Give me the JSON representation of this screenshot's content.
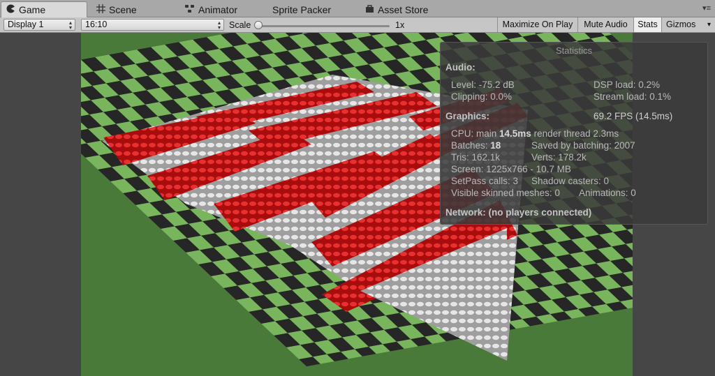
{
  "tabs": [
    {
      "label": "Game",
      "icon": "pacman-icon"
    },
    {
      "label": "Scene",
      "icon": "grid-icon"
    },
    {
      "label": "Animator",
      "icon": "animator-icon"
    },
    {
      "label": "Sprite Packer",
      "icon": ""
    },
    {
      "label": "Asset Store",
      "icon": "bag-icon"
    }
  ],
  "toolbar": {
    "display": "Display 1",
    "aspect": "16:10",
    "scale_label": "Scale",
    "scale_value": "1x",
    "maximize": "Maximize On Play",
    "mute": "Mute Audio",
    "stats": "Stats",
    "gizmos": "Gizmos"
  },
  "stats": {
    "title": "Statistics",
    "audio_header": "Audio:",
    "level": "Level: -75.2 dB",
    "clipping": "Clipping: 0.0%",
    "dsp": "DSP load: 0.2%",
    "stream": "Stream load: 0.1%",
    "graphics_header": "Graphics:",
    "fps": "69.2 FPS (14.5ms)",
    "cpu_prefix": "CPU: main ",
    "cpu_main": "14.5ms",
    "cpu_render": "  render thread 2.3ms",
    "batches_prefix": "Batches: ",
    "batches": "18",
    "saved": "Saved by batching: 2007",
    "tris": "Tris: 162.1k",
    "verts": "Verts: 178.2k",
    "screen": "Screen: 1225x766 - 10.7 MB",
    "setpass": "SetPass calls: 3",
    "shadow": "Shadow casters: 0",
    "skinned": "Visible skinned meshes: 0",
    "animations": "Animations: 0",
    "network": "Network: (no players connected)"
  },
  "colors": {
    "floor_green": "#79b55c",
    "floor_dark": "#262626",
    "cylinder_red": "#d11a1a",
    "cylinder_white": "#dcdcdc",
    "panel_bg": "#3a3a3a"
  }
}
